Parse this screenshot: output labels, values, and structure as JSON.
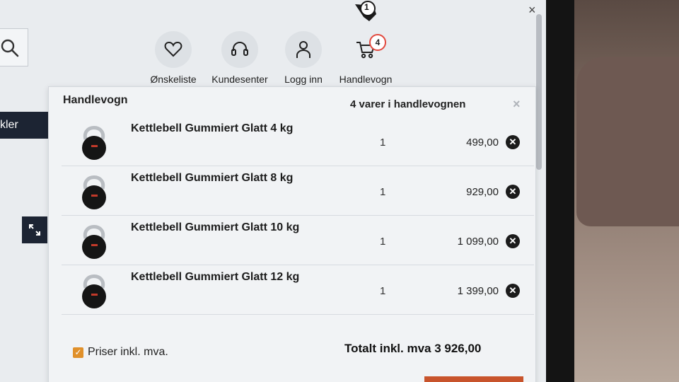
{
  "header": {
    "nav": [
      {
        "label": "Ønskeliste",
        "icon": "heart-icon"
      },
      {
        "label": "Kundesenter",
        "icon": "headset-icon"
      },
      {
        "label": "Logg inn",
        "icon": "user-icon"
      },
      {
        "label": "Handlevogn",
        "icon": "cart-icon",
        "badge": "4"
      }
    ],
    "promo_badge": "1"
  },
  "side_menu": {
    "label": "kler"
  },
  "cart": {
    "title": "Handlevogn",
    "count_text": "4 varer i handlevognen",
    "items": [
      {
        "name": "Kettlebell Gummiert Glatt 4 kg",
        "qty": "1",
        "price": "499,00"
      },
      {
        "name": "Kettlebell Gummiert Glatt 8 kg",
        "qty": "1",
        "price": "929,00"
      },
      {
        "name": "Kettlebell Gummiert Glatt 10 kg",
        "qty": "1",
        "price": "1 099,00"
      },
      {
        "name": "Kettlebell Gummiert Glatt 12 kg",
        "qty": "1",
        "price": "1 399,00"
      }
    ],
    "prices_incl_vat_label": "Priser inkl. mva.",
    "prices_incl_vat_checked": true,
    "total": "Totalt inkl. mva 3 926,00"
  },
  "colors": {
    "accent": "#e0902a",
    "badge_ring": "#e2483d",
    "dark_nav": "#1c2433"
  }
}
